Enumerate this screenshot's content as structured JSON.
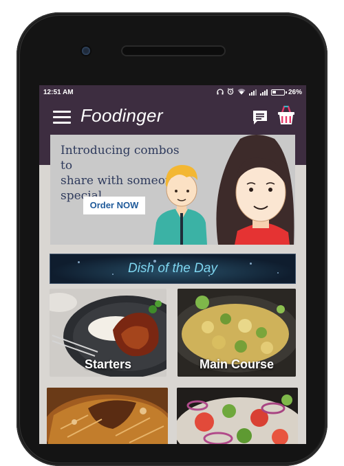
{
  "status_bar": {
    "time": "12:51 AM",
    "battery": "26%"
  },
  "app_bar": {
    "title": "Foodinger"
  },
  "promo": {
    "line1": "Introducing combos to",
    "line2": "share with someone",
    "line3": "special",
    "button": "Order NOW"
  },
  "dish_of_the_day": {
    "label": "Dish of the Day"
  },
  "categories": [
    {
      "label": "Starters"
    },
    {
      "label": "Main Course"
    },
    {
      "label": ""
    },
    {
      "label": ""
    }
  ],
  "colors": {
    "app_bar": "#3d2d40",
    "accent_text": "#7fd6f0",
    "promo_text": "#2e3a5c",
    "order_button_text": "#1f5a9a"
  }
}
